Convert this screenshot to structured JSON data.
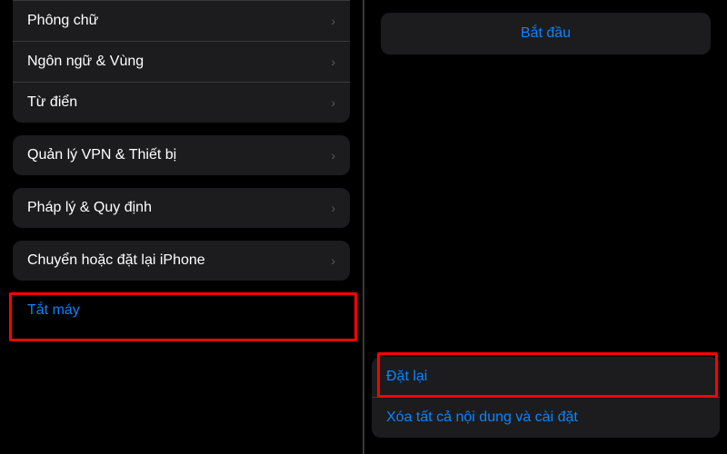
{
  "left": {
    "group1": {
      "items": [
        {
          "label": "Phông chữ"
        },
        {
          "label": "Ngôn ngữ & Vùng"
        },
        {
          "label": "Từ điển"
        }
      ]
    },
    "group2": {
      "items": [
        {
          "label": "Quản lý VPN & Thiết bị"
        }
      ]
    },
    "group3": {
      "items": [
        {
          "label": "Pháp lý & Quy định"
        }
      ]
    },
    "group4": {
      "items": [
        {
          "label": "Chuyển hoặc đặt lại iPhone"
        }
      ]
    },
    "shutdown": "Tắt máy"
  },
  "right": {
    "start_label": "Bắt đầu",
    "bottom": {
      "items": [
        {
          "label": "Đặt lại"
        },
        {
          "label": "Xóa tất cả nội dung và cài đặt"
        }
      ]
    }
  },
  "colors": {
    "accent": "#0a84ff",
    "highlight": "#ff0000"
  }
}
